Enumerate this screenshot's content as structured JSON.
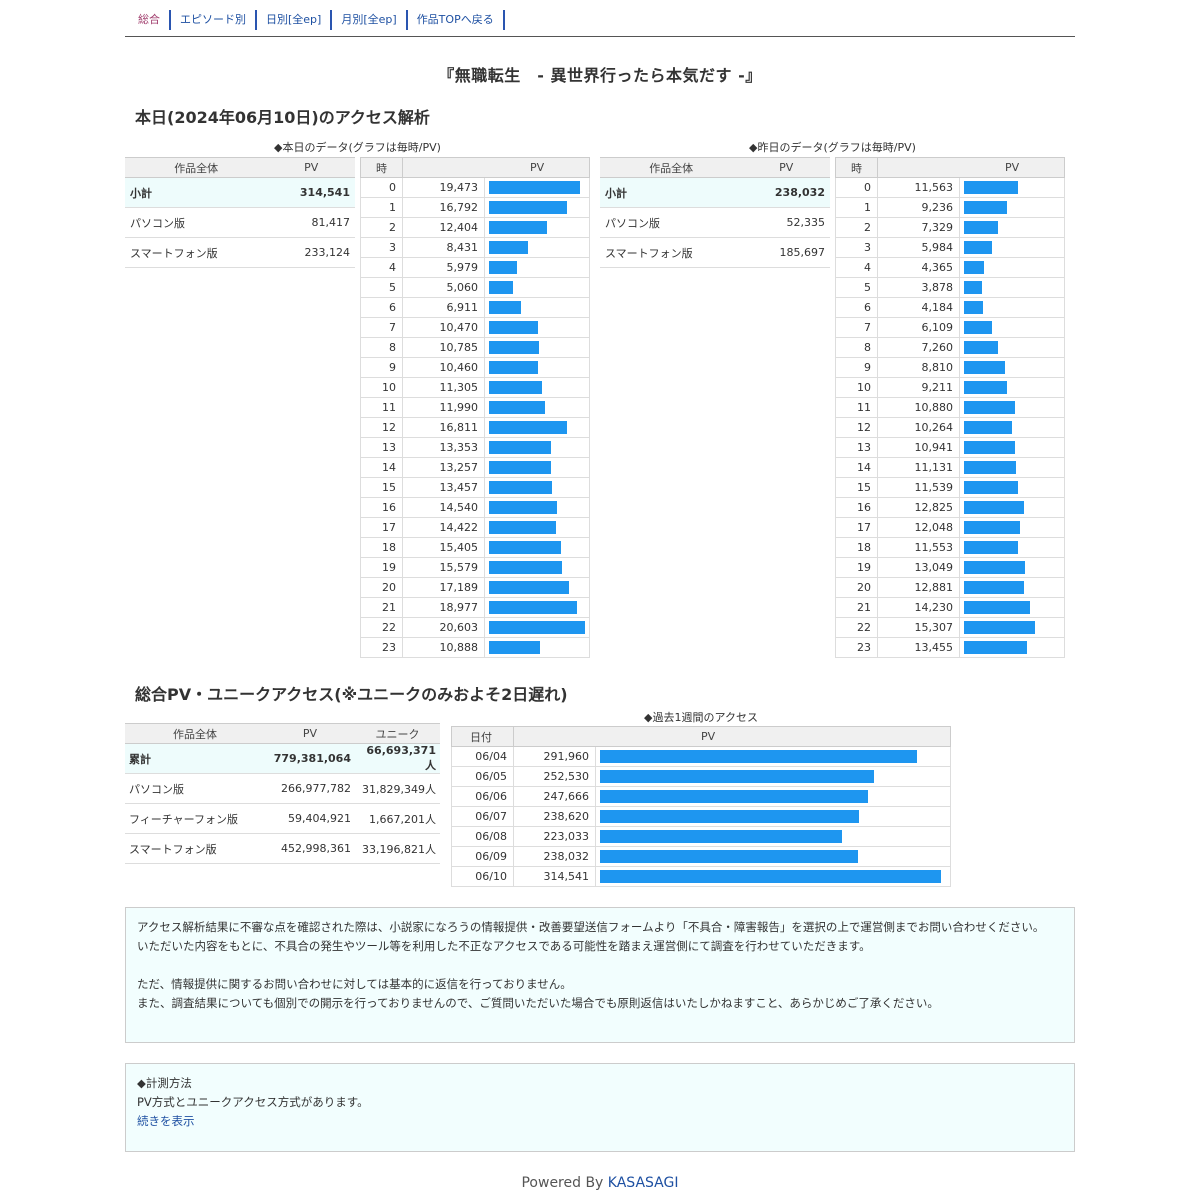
{
  "nav": [
    "総合",
    "エピソード別",
    "日別[全ep]",
    "月別[全ep]",
    "作品TOPへ戻る"
  ],
  "work_title": "『無職転生　- 異世界行ったら本気だす -』",
  "today_heading": "本日(2024年06月10日)のアクセス解析",
  "today": {
    "caption": "◆本日のデータ(グラフは毎時/PV)",
    "summary_headers": [
      "作品全体",
      "PV"
    ],
    "summary": [
      {
        "label": "小計",
        "value": "314,541"
      },
      {
        "label": "パソコン版",
        "value": "81,417"
      },
      {
        "label": "スマートフォン版",
        "value": "233,124"
      }
    ],
    "hour_headers": [
      "時",
      "PV"
    ],
    "hours": [
      "0",
      "1",
      "2",
      "3",
      "4",
      "5",
      "6",
      "7",
      "8",
      "9",
      "10",
      "11",
      "12",
      "13",
      "14",
      "15",
      "16",
      "17",
      "18",
      "19",
      "20",
      "21",
      "22",
      "23"
    ],
    "pv_labels": [
      "19,473",
      "16,792",
      "12,404",
      "8,431",
      "5,979",
      "5,060",
      "6,911",
      "10,470",
      "10,785",
      "10,460",
      "11,305",
      "11,990",
      "16,811",
      "13,353",
      "13,257",
      "13,457",
      "14,540",
      "14,422",
      "15,405",
      "15,579",
      "17,189",
      "18,977",
      "20,603",
      "10,888"
    ],
    "pv": [
      19473,
      16792,
      12404,
      8431,
      5979,
      5060,
      6911,
      10470,
      10785,
      10460,
      11305,
      11990,
      16811,
      13353,
      13257,
      13457,
      14540,
      14422,
      15405,
      15579,
      17189,
      18977,
      20603,
      10888
    ]
  },
  "yesterday": {
    "caption": "◆昨日のデータ(グラフは毎時/PV)",
    "summary_headers": [
      "作品全体",
      "PV"
    ],
    "summary": [
      {
        "label": "小計",
        "value": "238,032"
      },
      {
        "label": "パソコン版",
        "value": "52,335"
      },
      {
        "label": "スマートフォン版",
        "value": "185,697"
      }
    ],
    "hour_headers": [
      "時",
      "PV"
    ],
    "hours": [
      "0",
      "1",
      "2",
      "3",
      "4",
      "5",
      "6",
      "7",
      "8",
      "9",
      "10",
      "11",
      "12",
      "13",
      "14",
      "15",
      "16",
      "17",
      "18",
      "19",
      "20",
      "21",
      "22",
      "23"
    ],
    "pv_labels": [
      "11,563",
      "9,236",
      "7,329",
      "5,984",
      "4,365",
      "3,878",
      "4,184",
      "6,109",
      "7,260",
      "8,810",
      "9,211",
      "10,880",
      "10,264",
      "10,941",
      "11,131",
      "11,539",
      "12,825",
      "12,048",
      "11,553",
      "13,049",
      "12,881",
      "14,230",
      "15,307",
      "13,455"
    ],
    "pv": [
      11563,
      9236,
      7329,
      5984,
      4365,
      3878,
      4184,
      6109,
      7260,
      8810,
      9211,
      10880,
      10264,
      10941,
      11131,
      11539,
      12825,
      12048,
      11553,
      13049,
      12881,
      14230,
      15307,
      13455
    ]
  },
  "total_heading": "総合PV・ユニークアクセス(※ユニークのみおよそ2日遅れ)",
  "total": {
    "headers": [
      "作品全体",
      "PV",
      "ユニーク"
    ],
    "rows": [
      {
        "label": "累計",
        "pv": "779,381,064",
        "unique": "66,693,371人"
      },
      {
        "label": "パソコン版",
        "pv": "266,977,782",
        "unique": "31,829,349人"
      },
      {
        "label": "フィーチャーフォン版",
        "pv": "59,404,921",
        "unique": "1,667,201人"
      },
      {
        "label": "スマートフォン版",
        "pv": "452,998,361",
        "unique": "33,196,821人"
      }
    ]
  },
  "week": {
    "caption": "◆過去1週間のアクセス",
    "headers": [
      "日付",
      "PV"
    ],
    "dates": [
      "06/04",
      "06/05",
      "06/06",
      "06/07",
      "06/08",
      "06/09",
      "06/10"
    ],
    "pv_labels": [
      "291,960",
      "252,530",
      "247,666",
      "238,620",
      "223,033",
      "238,032",
      "314,541"
    ],
    "pv": [
      291960,
      252530,
      247666,
      238620,
      223033,
      238032,
      314541
    ]
  },
  "notice": {
    "line1": "アクセス解析結果に不審な点を確認された際は、小説家になろうの情報提供・改善要望送信フォームより「不具合・障害報告」を選択の上で運営側までお問い合わせください。",
    "line2": "いただいた内容をもとに、不具合の発生やツール等を利用した不正なアクセスである可能性を踏まえ運営側にて調査を行わせていただきます。",
    "line3": "ただ、情報提供に関するお問い合わせに対しては基本的に返信を行っておりません。",
    "line4": "また、調査結果についても個別での開示を行っておりませんので、ご質問いただいた場合でも原則返信はいたしかねますこと、あらかじめご了承ください。"
  },
  "method": {
    "title": "◆計測方法",
    "text": "PV方式とユニークアクセス方式があります。",
    "more_link": "続きを表示"
  },
  "footer": {
    "prefix": "Powered By ",
    "link": "KASASAGI"
  },
  "colors": {
    "bar": "#1e96f0",
    "highlight_row": "#eefcfc",
    "link": "#1e50a2"
  }
}
